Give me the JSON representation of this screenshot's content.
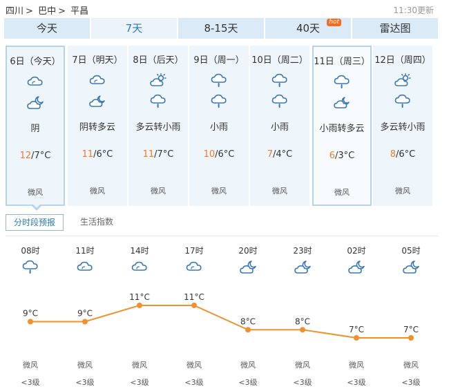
{
  "breadcrumb": {
    "province": "四川",
    "sep1": ">",
    "city": "巴中",
    "sep2": ">",
    "county": "平昌"
  },
  "updated": "11:30更新",
  "tabs": [
    {
      "label": "今天",
      "active": false
    },
    {
      "label": "7天",
      "active": true
    },
    {
      "label": "8-15天",
      "active": false
    },
    {
      "label": "40天",
      "active": false,
      "badge": "hot"
    },
    {
      "label": "雷达图",
      "active": false
    }
  ],
  "days": [
    {
      "date": "6日（今天）",
      "icon_day": "cloudy-icon",
      "icon_night": "cloudy-night-icon",
      "weather": "阴",
      "high": "12",
      "low": "/7°C",
      "wind": "微风"
    },
    {
      "date": "7日（明天）",
      "icon_day": "cloudy-icon",
      "icon_night": "partly-cloudy-night-icon",
      "weather": "阴转多云",
      "high": "11",
      "low": "/6°C",
      "wind": "微风"
    },
    {
      "date": "8日（后天）",
      "icon_day": "partly-cloudy-day-icon",
      "icon_night": "light-rain-icon",
      "weather": "多云转小雨",
      "high": "11",
      "low": "/7°C",
      "wind": "微风"
    },
    {
      "date": "9日（周一）",
      "icon_day": "light-rain-icon",
      "icon_night": "light-rain-icon",
      "weather": "小雨",
      "high": "10",
      "low": "/6°C",
      "wind": "微风"
    },
    {
      "date": "10日（周二）",
      "icon_day": "light-rain-icon",
      "icon_night": "light-rain-icon",
      "weather": "小雨",
      "high": "7",
      "low": "/4°C",
      "wind": "微风"
    },
    {
      "date": "11日（周三）",
      "icon_day": "light-rain-icon",
      "icon_night": "partly-cloudy-night-icon",
      "weather": "小雨转多云",
      "high": "6",
      "low": "/3°C",
      "wind": "微风"
    },
    {
      "date": "12日（周四）",
      "icon_day": "partly-cloudy-day-icon",
      "icon_night": "light-rain-icon",
      "weather": "多云转小雨",
      "high": "8",
      "low": "/6°C",
      "wind": "微风"
    }
  ],
  "subtabs": {
    "hourly": "分时段预报",
    "life": "生活指数"
  },
  "colors": {
    "accent": "#2a7ab8",
    "temp_high": "#f07a2a",
    "line": "#f0912f",
    "tab_bg": "#dbeaf7",
    "card_bg": "#eef5fb"
  },
  "hourly": [
    {
      "time": "08时",
      "icon": "light-rain-icon",
      "temp": "9°C",
      "wind": "微风",
      "level": "<3级"
    },
    {
      "time": "11时",
      "icon": "cloudy-icon",
      "temp": "9°C",
      "wind": "微风",
      "level": "<3级"
    },
    {
      "time": "14时",
      "icon": "cloudy-icon",
      "temp": "11°C",
      "wind": "微风",
      "level": "<3级"
    },
    {
      "time": "17时",
      "icon": "cloudy-icon",
      "temp": "11°C",
      "wind": "微风",
      "level": "<3级"
    },
    {
      "time": "20时",
      "icon": "cloudy-night-icon",
      "temp": "8°C",
      "wind": "微风",
      "level": "<3级"
    },
    {
      "time": "23时",
      "icon": "cloudy-night-icon",
      "temp": "8°C",
      "wind": "微风",
      "level": "<3级"
    },
    {
      "time": "02时",
      "icon": "cloudy-night-icon",
      "temp": "7°C",
      "wind": "微风",
      "level": "<3级"
    },
    {
      "time": "05时",
      "icon": "cloudy-night-icon",
      "temp": "7°C",
      "wind": "微风",
      "level": "<3级"
    }
  ],
  "chart_data": {
    "type": "line",
    "x": [
      "08时",
      "11时",
      "14时",
      "17时",
      "20时",
      "23时",
      "02时",
      "05时"
    ],
    "series": [
      {
        "values": [
          9,
          9,
          11,
          11,
          8,
          8,
          7,
          7
        ]
      }
    ]
  }
}
